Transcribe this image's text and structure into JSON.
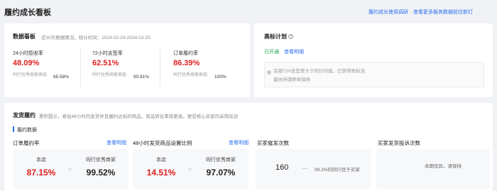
{
  "header": {
    "title": "履约成长看板",
    "link_survey": "履约成长使用调研",
    "link_more": "查看更多服务数据前往新灯"
  },
  "dashboard": {
    "title": "数据看板",
    "subtitle": "近30天数据情况，统计时间：2024-02-24-2024-03-25",
    "metrics": [
      {
        "label": "24小时揽收率",
        "value": "48.09%",
        "peer_label": "同行优秀商家表现",
        "peer_value": "85.58%"
      },
      {
        "label": "72小时支签率",
        "value": "62.51%",
        "peer_label": "同行优秀商家表现",
        "peer_value": "90.91%"
      },
      {
        "label": "订单履约率",
        "value": "86.39%",
        "peer_label": "同行优秀商家表现",
        "peer_value": "100%"
      }
    ]
  },
  "benchmark": {
    "title": "高标计划",
    "status": "已开通",
    "detail_link": "查看明细",
    "notice_line1": "店铺72H支签率大于同行均值，已获得亮标流",
    "notice_line2": "量扶持请继续保持"
  },
  "shipping": {
    "title": "发货履约",
    "desc": "累积提示，参加48小时内发货并且履约达标的商品，商品转化率将更高，更受核心买家的采购欢迎",
    "tab_label": "履约数据",
    "kpis": [
      {
        "title": "订单履约率",
        "link": "查看明细",
        "left_label": "本店",
        "left_value": "87.15%",
        "right_label": "同行优秀商家",
        "right_value": "99.52%",
        "vs": "vs"
      },
      {
        "title": "48小时发货商品设置比例",
        "link": "查看明细",
        "left_label": "本店",
        "left_value": "14.51%",
        "right_label": "同行优秀商家",
        "right_value": "97.07%",
        "vs": "vs"
      }
    ],
    "repeat": {
      "title": "买家催发次数",
      "value": "160",
      "compare": "99.3%的同行优于买家"
    },
    "complaint": {
      "title": "买家发货投诉次数",
      "text": "本期优异，请保持"
    }
  },
  "colors": {
    "accent": "#2a6ef2",
    "danger": "#e02020",
    "success": "#17a34a"
  }
}
